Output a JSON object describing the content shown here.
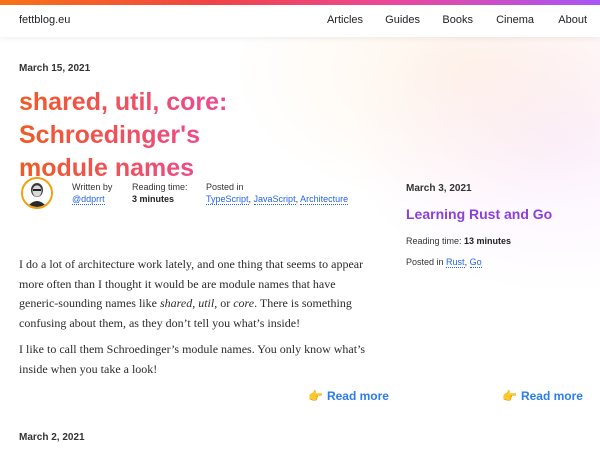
{
  "site": {
    "brand": "fettblog.eu",
    "nav": [
      "Articles",
      "Guides",
      "Books",
      "Cinema",
      "About"
    ]
  },
  "main_post": {
    "date": "March 15, 2021",
    "title_line1": "shared, util, core: Schroedinger's",
    "title_line2": "module names",
    "written_by_label": "Written by",
    "author": "@ddprrt",
    "reading_time_label": "Reading time:",
    "reading_time": "3 minutes",
    "posted_in_label": "Posted in",
    "tags": [
      "TypeScript",
      "JavaScript",
      "Architecture"
    ],
    "para1_a": "I do a lot of architecture work lately, and one thing that seems to appear more often than I thought it would be are module names that have generic-sounding names like ",
    "para1_em1": "shared",
    "para1_sep1": ", ",
    "para1_em2": "util",
    "para1_sep2": ", or ",
    "para1_em3": "core",
    "para1_b": ". There is something confusing about them, as they don’t tell you what’s inside!",
    "para2": "I like to call them Schroedinger’s module names. You only know what’s inside when you take a look!",
    "read_more": "Read more"
  },
  "side_post": {
    "date": "March 3, 2021",
    "title": "Learning Rust and Go",
    "reading_time_label": "Reading time:",
    "reading_time": "13 minutes",
    "posted_in_label": "Posted in",
    "tags": [
      "Rust",
      "Go"
    ],
    "read_more": "Read more"
  },
  "next_post": {
    "date": "March 2, 2021"
  },
  "icons": {
    "read_more": "pointing-hand-icon",
    "read_more_glyph": "👉"
  },
  "colors": {
    "accent_gradient": [
      "#f97316",
      "#ef4444",
      "#ec4899",
      "#a855f7"
    ],
    "link": "#2563eb",
    "read_more": "#2b7de9",
    "side_title": "#8b3fd9"
  }
}
